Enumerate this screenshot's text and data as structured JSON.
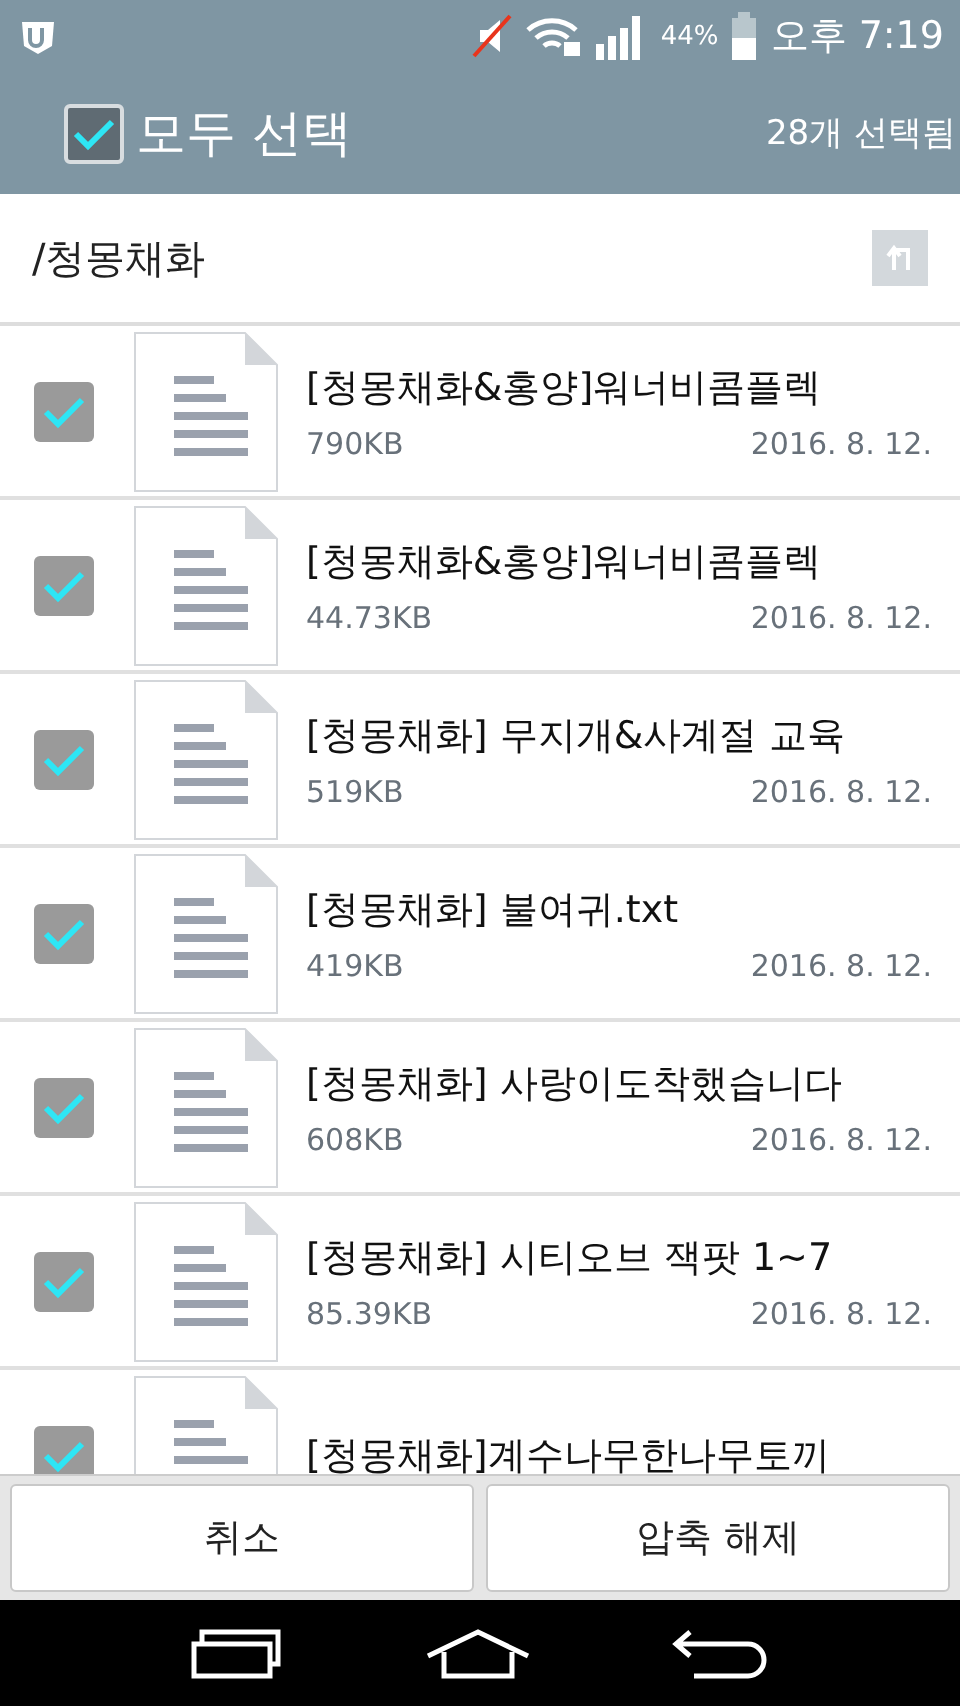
{
  "status_bar": {
    "battery_percent": "44%",
    "time": "오후 7:19"
  },
  "header": {
    "select_all": {
      "label": "모두 선택",
      "checked": true
    },
    "selected_count": "28개 선택됨"
  },
  "path": "/청몽채화",
  "files": [
    {
      "name": "[청몽채화&홍양]워너비콤플렉",
      "size": "790KB",
      "date": "2016. 8. 12.",
      "checked": true
    },
    {
      "name": "[청몽채화&홍양]워너비콤플렉",
      "size": "44.73KB",
      "date": "2016. 8. 12.",
      "checked": true
    },
    {
      "name": "[청몽채화] 무지개&사계절 교육",
      "size": "519KB",
      "date": "2016. 8. 12.",
      "checked": true
    },
    {
      "name": "[청몽채화] 불여귀.txt",
      "size": "419KB",
      "date": "2016. 8. 12.",
      "checked": true
    },
    {
      "name": "[청몽채화] 사랑이도착했습니다",
      "size": "608KB",
      "date": "2016. 8. 12.",
      "checked": true
    },
    {
      "name": "[청몽채화] 시티오브 잭팟 1~7",
      "size": "85.39KB",
      "date": "2016. 8. 12.",
      "checked": true
    },
    {
      "name": "[청몽채화]계수나무한나무토끼",
      "checked": true
    }
  ],
  "buttons": [
    "취소",
    "압축 해제"
  ]
}
